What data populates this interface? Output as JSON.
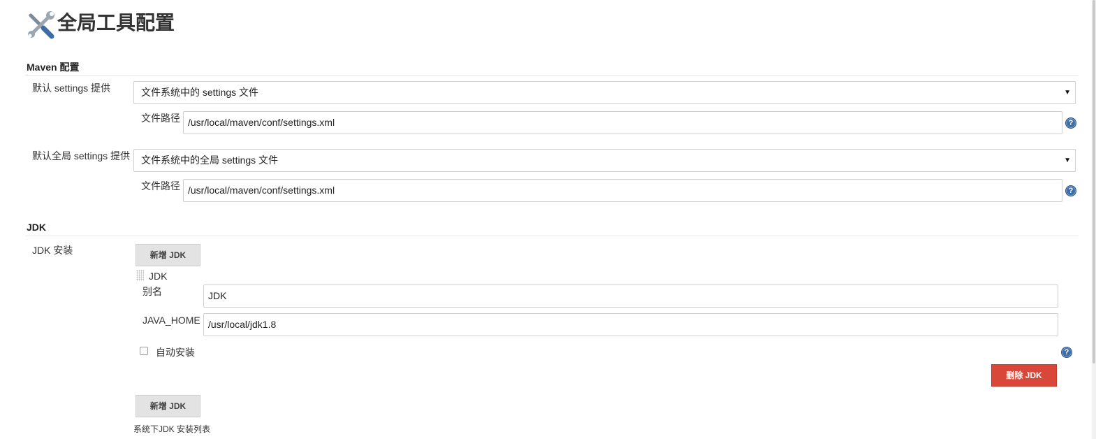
{
  "page": {
    "title": "全局工具配置"
  },
  "maven": {
    "section_title": "Maven 配置",
    "settings": {
      "label": "默认 settings 提供",
      "selected": "文件系统中的 settings 文件",
      "path_label": "文件路径",
      "path_value": "/usr/local/maven/conf/settings.xml"
    },
    "global_settings": {
      "label": "默认全局 settings 提供",
      "selected": "文件系统中的全局 settings 文件",
      "path_label": "文件路径",
      "path_value": "/usr/local/maven/conf/settings.xml"
    }
  },
  "jdk": {
    "section_title": "JDK",
    "install_label": "JDK 安装",
    "add_button": "新增 JDK",
    "item_header": "JDK",
    "alias_label": "别名",
    "alias_value": "JDK",
    "java_home_label": "JAVA_HOME",
    "java_home_value": "/usr/local/jdk1.8",
    "auto_install_label": "自动安装",
    "auto_install_checked": false,
    "delete_button": "删除 JDK",
    "add_button_2": "新增 JDK",
    "list_caption": "系统下JDK 安装列表"
  },
  "icons": {
    "title": "tools-icon",
    "help": "help-icon",
    "dropdown": "caret-down-icon",
    "drag": "drag-handle-icon"
  },
  "colors": {
    "delete_button": "#d9473a",
    "help_icon": "#3d6ea8",
    "add_button_bg": "#e3e3e3"
  }
}
